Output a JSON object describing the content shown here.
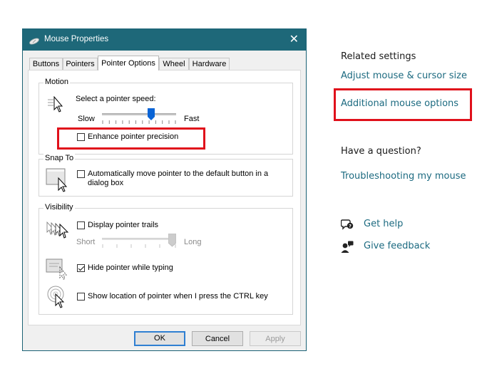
{
  "window": {
    "title": "Mouse Properties",
    "close_glyph": "✕"
  },
  "tabs": [
    {
      "label": "Buttons"
    },
    {
      "label": "Pointers"
    },
    {
      "label": "Pointer Options"
    },
    {
      "label": "Wheel"
    },
    {
      "label": "Hardware"
    }
  ],
  "active_tab": "Pointer Options",
  "motion": {
    "label": "Motion",
    "speed_label": "Select a pointer speed:",
    "slow_label": "Slow",
    "fast_label": "Fast",
    "speed_level": 0.68,
    "enhance_label": "Enhance pointer precision",
    "enhance_checked": false
  },
  "snap_to": {
    "label": "Snap To",
    "option_line1": "Automatically move pointer to the default button in a",
    "option_line2": "dialog box",
    "checked": false
  },
  "visibility": {
    "label": "Visibility",
    "trails_label": "Display pointer trails",
    "trails_checked": false,
    "short_label": "Short",
    "long_label": "Long",
    "trail_level": 1.0,
    "hide_label": "Hide pointer while typing",
    "hide_checked": true,
    "ctrl_label": "Show location of pointer when I press the CTRL key",
    "ctrl_checked": false
  },
  "buttons": {
    "ok": "OK",
    "cancel": "Cancel",
    "apply": "Apply"
  },
  "side": {
    "related_heading": "Related settings",
    "adjust_link": "Adjust mouse & cursor size",
    "additional_link": "Additional mouse options",
    "question_heading": "Have a question?",
    "troubleshoot_link": "Troubleshooting my mouse",
    "get_help": "Get help",
    "give_feedback": "Give feedback"
  },
  "colors": {
    "titlebar": "#1e6879",
    "link": "#1c6a80",
    "highlight_box": "#e0101b",
    "slider_thumb": "#0a64d6"
  }
}
